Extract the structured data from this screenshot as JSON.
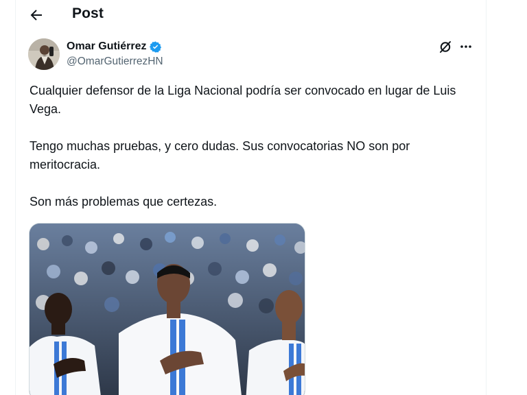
{
  "header": {
    "title": "Post",
    "back_icon": "arrow-left-icon"
  },
  "post": {
    "author": {
      "display_name": "Omar Gutiérrez",
      "handle": "@OmarGutierrezHN",
      "verified": true,
      "verified_color": "#1d9bf0"
    },
    "paragraphs": [
      "Cualquier defensor de la Liga Nacional podría ser convocado en lugar de Luis Vega.",
      "Tengo muchas pruebas, y cero dudas. Sus convocatorias NO son por meritocracia.",
      "Son más problemas que certezas."
    ],
    "actions": {
      "grok_icon": "grok-icon",
      "more_icon": "more-icon"
    }
  },
  "colors": {
    "text_primary": "#0f1419",
    "text_secondary": "#536471",
    "accent": "#1d9bf0",
    "border": "#eff3f4"
  }
}
